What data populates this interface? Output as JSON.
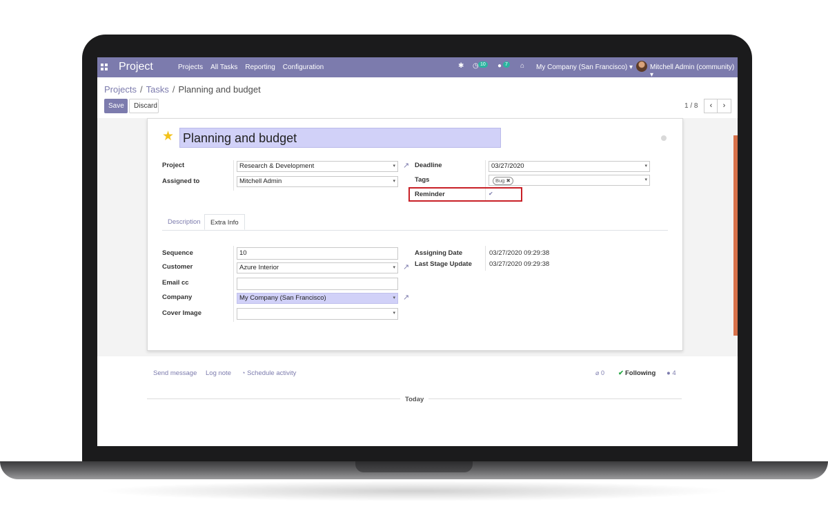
{
  "navbar": {
    "brand": "Project",
    "menu": [
      "Projects",
      "All Tasks",
      "Reporting",
      "Configuration"
    ],
    "activity_badge": "10",
    "message_badge": "7",
    "company": "My Company (San Francisco)",
    "user": "Mitchell Admin (community)",
    "color": "#7c7bad"
  },
  "breadcrumb": [
    "Projects",
    "Tasks",
    "Planning and budget"
  ],
  "buttons": {
    "save": "Save",
    "discard": "Discard"
  },
  "pager": {
    "value": "1 / 8"
  },
  "form": {
    "title": "Planning and budget",
    "project": {
      "label": "Project",
      "value": "Research & Development"
    },
    "assigned_to": {
      "label": "Assigned to",
      "value": "Mitchell Admin"
    },
    "deadline": {
      "label": "Deadline",
      "value": "03/27/2020"
    },
    "tags": {
      "label": "Tags",
      "items": [
        "Bug"
      ]
    },
    "reminder": {
      "label": "Reminder",
      "checked": true
    }
  },
  "tabs": [
    "Description",
    "Extra Info"
  ],
  "extra_info": {
    "sequence": {
      "label": "Sequence",
      "value": "10"
    },
    "customer": {
      "label": "Customer",
      "value": "Azure Interior"
    },
    "email_cc": {
      "label": "Email cc",
      "value": ""
    },
    "company": {
      "label": "Company",
      "value": "My Company (San Francisco)"
    },
    "cover_image": {
      "label": "Cover Image",
      "value": ""
    },
    "assigning_date": {
      "label": "Assigning Date",
      "value": "03/27/2020 09:29:38"
    },
    "last_stage_update": {
      "label": "Last Stage Update",
      "value": "03/27/2020 09:29:38"
    }
  },
  "chatter": {
    "send_message": "Send message",
    "log_note": "Log note",
    "schedule_activity": "Schedule activity",
    "attachments": "0",
    "following": "Following",
    "followers": "4",
    "today": "Today"
  },
  "icons": [
    "apps-icon",
    "bug-icon",
    "activity-icon",
    "chat-icon",
    "gift-icon",
    "star-icon",
    "external-link-icon",
    "paperclip-icon",
    "check-icon",
    "user-icon",
    "clock-icon"
  ]
}
